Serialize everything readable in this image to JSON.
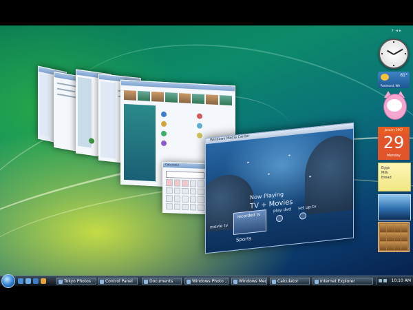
{
  "taskbar": {
    "buttons": [
      {
        "label": "Tokyo Photos"
      },
      {
        "label": "Control Panel"
      },
      {
        "label": "Documents"
      },
      {
        "label": "Windows Photo ..."
      },
      {
        "label": "Windows Media ..."
      },
      {
        "label": "Calculator"
      },
      {
        "label": "Internet Explorer"
      }
    ],
    "clock": "10:10 AM"
  },
  "media_center": {
    "title": "Windows Media Center",
    "now_playing": "Now Playing",
    "category": "TV + Movies",
    "recorded_tv": "recorded tv",
    "live_tv": "movie tv",
    "play_dvd": "play dvd",
    "setup": "set up tv",
    "sports": "Sports"
  },
  "calculator": {
    "title": "Calculator"
  },
  "gadgets": {
    "weather_temp": "61°",
    "weather_location": "Redmond, WA",
    "calendar_month": "January 2007",
    "calendar_day": "29",
    "calendar_weekday": "Monday",
    "notes": [
      "Eggs",
      "Milk",
      "Bread"
    ]
  },
  "colors": {
    "accent": "#2d7fd0",
    "calendar": "#e2552b"
  }
}
